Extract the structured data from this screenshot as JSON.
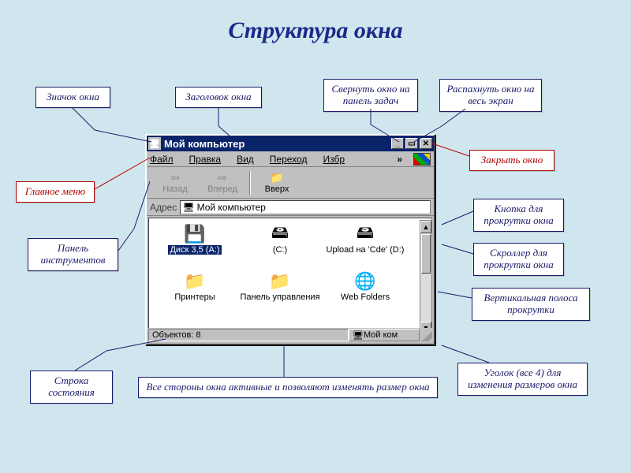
{
  "page_title": "Структура окна",
  "callouts": {
    "window_icon": "Значок окна",
    "window_title": "Заголовок окна",
    "minimize": "Свернуть окно на панель задач",
    "maximize": "Распахнуть окно на весь экран",
    "close": "Закрыть окно",
    "main_menu": "Главное меню",
    "toolbar": "Панель инструментов",
    "scroll_button": "Кнопка для прокрутки окна",
    "scroll_thumb": "Скроллер для прокрутки окна",
    "scrollbar": "Вертикальная полоса прокрутки",
    "status_bar": "Строка состояния",
    "sides_active": "Все стороны окна активные и позволяют изменять размер окна",
    "resize_corner": "Уголок  (все 4) для изменения размеров окна"
  },
  "window": {
    "title": "Мой компьютер",
    "menu": {
      "file": "Файл",
      "edit": "Правка",
      "view": "Вид",
      "go": "Переход",
      "fav": "Избр",
      "chev": "»"
    },
    "toolbar": {
      "back": "Назад",
      "forward": "Вперед",
      "up": "Вверх"
    },
    "address": {
      "label": "Адрес",
      "value": "Мой компьютер"
    },
    "items": [
      {
        "label": "Диск 3,5 (A:)",
        "icon": "floppy-icon"
      },
      {
        "label": "(C:)",
        "icon": "drive-icon"
      },
      {
        "label": "Upload на 'Cde' (D:)",
        "icon": "netdrive-icon"
      },
      {
        "label": "Принтеры",
        "icon": "folder-icon"
      },
      {
        "label": "Панель управления",
        "icon": "folder-icon"
      },
      {
        "label": "Web Folders",
        "icon": "webfolder-icon"
      }
    ],
    "status": {
      "objects": "Объектов: 8",
      "zone": "Мой ком"
    }
  }
}
